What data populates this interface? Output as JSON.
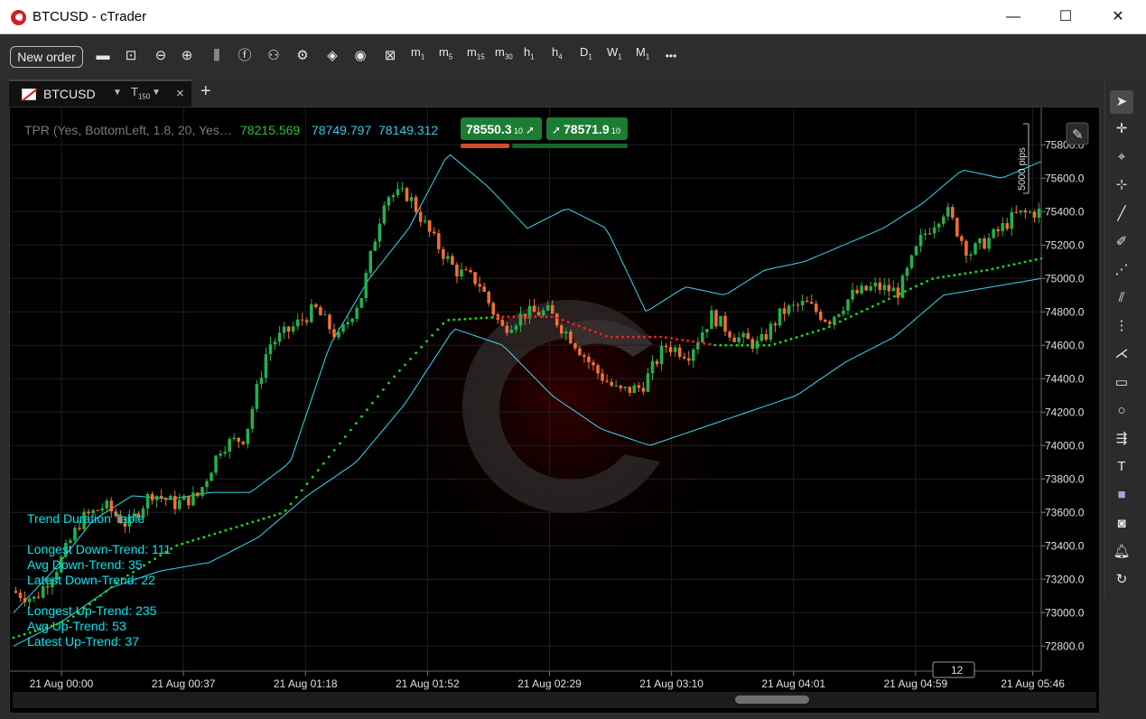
{
  "window": {
    "title": "BTCUSD - cTrader",
    "minimize": "—",
    "maximize": "☐",
    "close": "✕"
  },
  "toolbar": {
    "new_order": "New order",
    "timeframes": [
      {
        "main": "m",
        "sub": "1"
      },
      {
        "main": "m",
        "sub": "5"
      },
      {
        "main": "m",
        "sub": "15"
      },
      {
        "main": "m",
        "sub": "30"
      },
      {
        "main": "h",
        "sub": "1"
      },
      {
        "main": "h",
        "sub": "4"
      },
      {
        "main": "D",
        "sub": "1"
      },
      {
        "main": "W",
        "sub": "1"
      },
      {
        "main": "M",
        "sub": "1"
      }
    ],
    "more": "•••"
  },
  "tab": {
    "symbol": "BTCUSD",
    "timeframe_main": "T",
    "timeframe_sub": "150",
    "close": "×",
    "add": "+"
  },
  "chart": {
    "indicator_label": "TPR (Yes, BottomLeft, 1.8, 20, Yes…",
    "indicator_value_1": "78215.569",
    "indicator_value_2": "78749.797",
    "indicator_value_3": "78149.312",
    "sell_price": "78550.3",
    "sell_sub": "10",
    "buy_price": "78571.9",
    "buy_sub": "10",
    "pips_label": "5000 pips",
    "bar_count": "12",
    "colors": {
      "bull": "#22b14c",
      "bear": "#f07033",
      "band": "#38d9f0",
      "dots_up": "#14e014",
      "dots_down": "#ff2020",
      "background": "#000000"
    }
  },
  "chart_data": {
    "type": "candlestick",
    "y_ticks": [
      "75800.0",
      "75600.0",
      "75400.0",
      "75200.0",
      "75000.0",
      "74800.0",
      "74600.0",
      "74400.0",
      "74200.0",
      "74000.0",
      "73800.0",
      "73600.0",
      "73400.0",
      "73200.0",
      "73000.0",
      "72800.0"
    ],
    "x_ticks": [
      "21 Aug 00:00",
      "21 Aug 00:37",
      "21 Aug 01:18",
      "21 Aug 01:52",
      "21 Aug 02:29",
      "21 Aug 03:10",
      "21 Aug 04:01",
      "21 Aug 04:59",
      "21 Aug 05:46"
    ],
    "ylim": [
      72650,
      75980
    ],
    "close_path": [
      73130,
      73080,
      73280,
      73560,
      73640,
      73520,
      73720,
      73650,
      73700,
      74000,
      74050,
      74600,
      74700,
      74820,
      74640,
      74900,
      75500,
      75500,
      75250,
      75050,
      74980,
      74700,
      74790,
      74800,
      74640,
      74450,
      74320,
      74350,
      74600,
      74550,
      74780,
      74650,
      74600,
      74800,
      74850,
      74750,
      74900,
      74950,
      74920,
      75250,
      75420,
      75150,
      75250,
      75380,
      75400
    ],
    "upper_band": [
      73000,
      73250,
      73550,
      73700,
      73680,
      73720,
      73720,
      73900,
      74600,
      75000,
      75300,
      75750,
      75550,
      75300,
      75420,
      75300,
      74800,
      74950,
      74900,
      75050,
      75100,
      75200,
      75300,
      75450,
      75650,
      75600,
      75700
    ],
    "lower_band": [
      72800,
      72950,
      73150,
      73250,
      73300,
      73450,
      73700,
      73900,
      74250,
      74700,
      74600,
      74300,
      74100,
      74000,
      74100,
      74200,
      74300,
      74500,
      74650,
      74900,
      74950,
      75000
    ],
    "trend_dots": [
      72850,
      72950,
      73200,
      73400,
      73500,
      73600,
      74000,
      74400,
      74750,
      74770,
      74770,
      74650,
      74650,
      74600,
      74600,
      74700,
      74850,
      75000,
      75050,
      75120
    ]
  },
  "trend_table": {
    "title": "Trend Duration Table",
    "lines": [
      "Longest Down-Trend: 111",
      "Avg Down-Trend: 35",
      "Latest Down-Trend: 22",
      "",
      "Longest Up-Trend: 235",
      "Avg Up-Trend: 53",
      "Latest Up-Trend: 37"
    ]
  }
}
